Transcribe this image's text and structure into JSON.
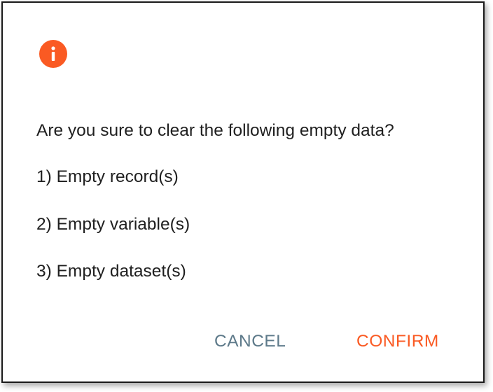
{
  "dialog": {
    "icon": "info-icon",
    "message": "Are you sure to clear the following empty data?",
    "items": [
      "1) Empty record(s)",
      "2) Empty variable(s)",
      "3) Empty dataset(s)"
    ],
    "cancel_label": "CANCEL",
    "confirm_label": "CONFIRM"
  },
  "colors": {
    "accent": "#fa5a23",
    "cancel_text": "#5e7a8a",
    "confirm_text": "#fa5a23",
    "body_text": "#1f1f1f"
  }
}
